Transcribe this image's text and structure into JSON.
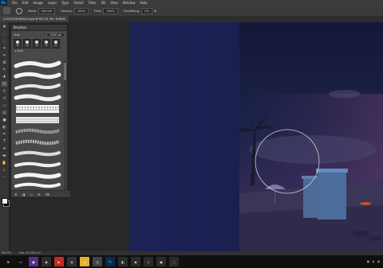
{
  "app": {
    "logo": "Ps"
  },
  "menu": [
    "File",
    "Edit",
    "Image",
    "Layer",
    "Type",
    "Select",
    "Filter",
    "3D",
    "View",
    "Window",
    "Help"
  ],
  "options": {
    "mode_label": "Mode:",
    "mode_value": "Normal",
    "opacity_label": "Opacity:",
    "opacity_value": "100%",
    "flow_label": "Flow:",
    "flow_value": "100%",
    "smoothing_label": "Smoothing:",
    "smoothing_value": "0%"
  },
  "document": {
    "tab": "LOCATION BEACH.psd @ 66.7% (Pe, RGB/8)"
  },
  "brushes_panel": {
    "title": "Brushes",
    "size_label": "Size:",
    "size_value": "1000 px",
    "presets": [
      "30",
      "30",
      "30",
      "25",
      "25"
    ],
    "group": "Kyle"
  },
  "status": {
    "zoom": "66.67%",
    "doc": "Doc: 42.1M/1.5G"
  },
  "colors": {
    "accent": "#31a8ff",
    "canvas_sky_top": "#141a3c",
    "canvas_sky_bottom": "#3d2e5c"
  }
}
